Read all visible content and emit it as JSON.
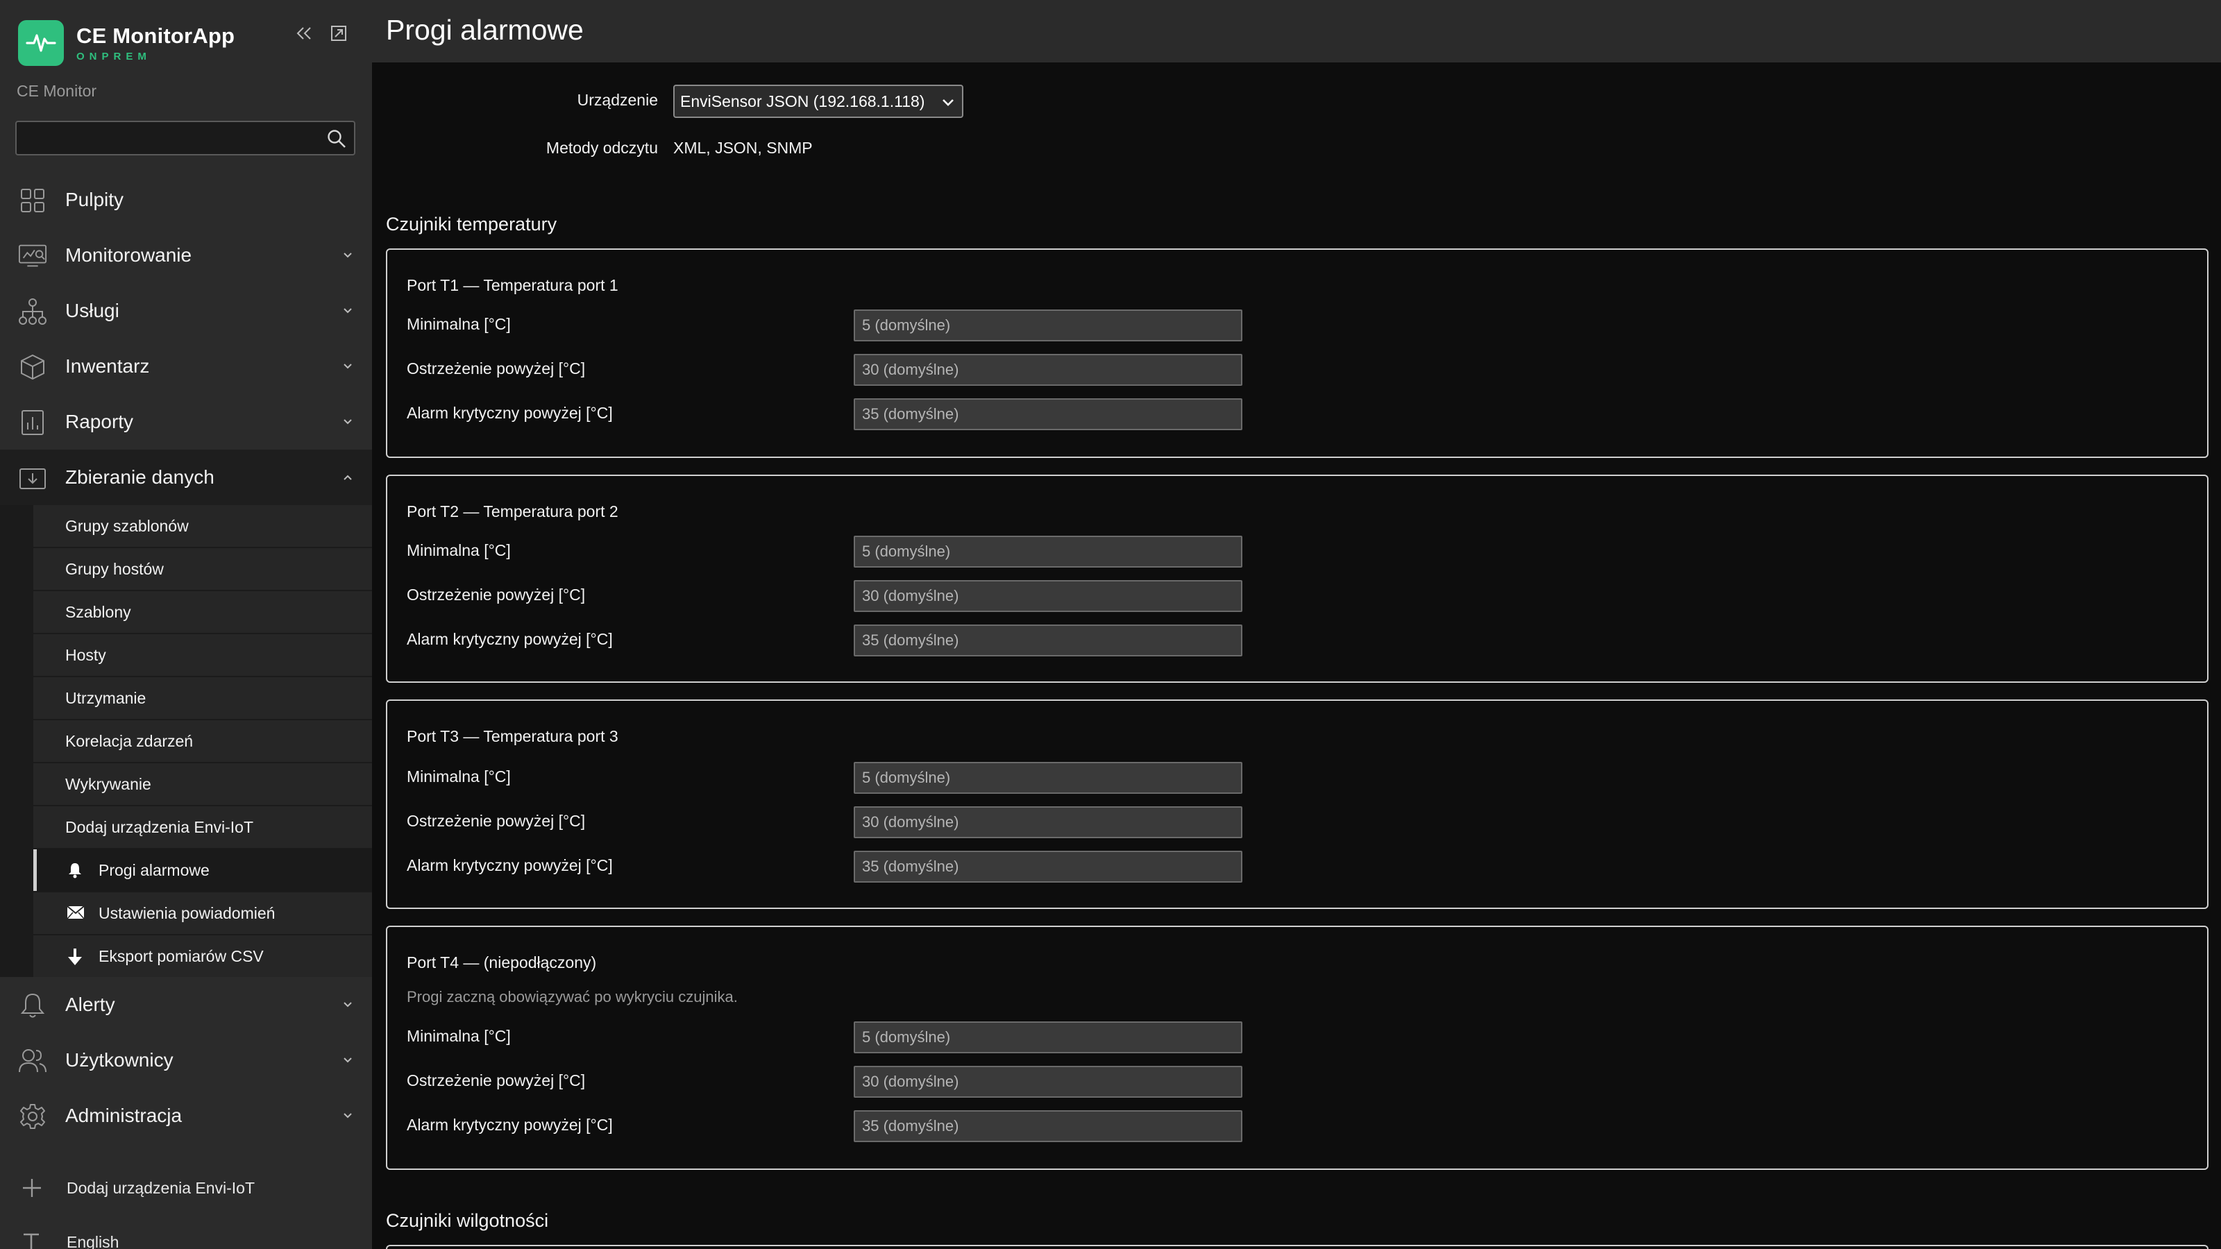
{
  "app": {
    "brand_name": "CE MonitorApp",
    "brand_sub": "ONPREM",
    "subtitle": "CE Monitor",
    "accent_color": "#2fbf7e"
  },
  "search": {
    "placeholder": "",
    "value": ""
  },
  "nav": {
    "items": [
      {
        "label": "Pulpity",
        "icon": "dashboard-grid-icon",
        "has_chevron": false
      },
      {
        "label": "Monitorowanie",
        "icon": "monitor-chart-icon",
        "has_chevron": true
      },
      {
        "label": "Usługi",
        "icon": "services-tree-icon",
        "has_chevron": true
      },
      {
        "label": "Inwentarz",
        "icon": "box-icon",
        "has_chevron": true
      },
      {
        "label": "Raporty",
        "icon": "report-icon",
        "has_chevron": true
      },
      {
        "label": "Zbieranie danych",
        "icon": "data-download-icon",
        "has_chevron": true,
        "expanded": true
      }
    ],
    "submenu": [
      {
        "label": "Grupy szablonów"
      },
      {
        "label": "Grupy hostów"
      },
      {
        "label": "Szablony"
      },
      {
        "label": "Hosty"
      },
      {
        "label": "Utrzymanie"
      },
      {
        "label": "Korelacja zdarzeń"
      },
      {
        "label": "Wykrywanie"
      },
      {
        "label": "Dodaj urządzenia Envi-IoT"
      },
      {
        "label": "Progi alarmowe",
        "icon": "bell-icon",
        "active": true
      },
      {
        "label": "Ustawienia powiadomień",
        "icon": "envelope-icon"
      },
      {
        "label": "Eksport pomiarów CSV",
        "icon": "arrow-down-icon"
      }
    ],
    "items_after": [
      {
        "label": "Alerty",
        "icon": "bell-outline-icon",
        "has_chevron": true
      },
      {
        "label": "Użytkownicy",
        "icon": "users-icon",
        "has_chevron": true
      },
      {
        "label": "Administracja",
        "icon": "gear-icon",
        "has_chevron": true
      }
    ],
    "bottom": [
      {
        "label": "Dodaj urządzenia Envi-IoT",
        "icon": "plus-icon"
      },
      {
        "label": "English",
        "icon": "text-t-icon"
      }
    ]
  },
  "page": {
    "title": "Progi alarmowe",
    "device_label": "Urządzenie",
    "device_value": "EnviSensor JSON (192.168.1.118)",
    "methods_label": "Metody odczytu",
    "methods_value": "XML, JSON, SNMP",
    "temp_section": "Czujniki temperatury",
    "humidity_section": "Czujniki wilgotności"
  },
  "ports": [
    {
      "title": "Port T1 — Temperatura port 1",
      "note": "",
      "fields": [
        {
          "label": "Minimalna [°C]",
          "placeholder": "5 (domyślne)"
        },
        {
          "label": "Ostrzeżenie powyżej [°C]",
          "placeholder": "30 (domyślne)"
        },
        {
          "label": "Alarm krytyczny powyżej [°C]",
          "placeholder": "35 (domyślne)"
        }
      ]
    },
    {
      "title": "Port T2 — Temperatura port 2",
      "note": "",
      "fields": [
        {
          "label": "Minimalna [°C]",
          "placeholder": "5 (domyślne)"
        },
        {
          "label": "Ostrzeżenie powyżej [°C]",
          "placeholder": "30 (domyślne)"
        },
        {
          "label": "Alarm krytyczny powyżej [°C]",
          "placeholder": "35 (domyślne)"
        }
      ]
    },
    {
      "title": "Port T3 — Temperatura port 3",
      "note": "",
      "fields": [
        {
          "label": "Minimalna [°C]",
          "placeholder": "5 (domyślne)"
        },
        {
          "label": "Ostrzeżenie powyżej [°C]",
          "placeholder": "30 (domyślne)"
        },
        {
          "label": "Alarm krytyczny powyżej [°C]",
          "placeholder": "35 (domyślne)"
        }
      ]
    },
    {
      "title": "Port T4 — (niepodłączony)",
      "note": "Progi zaczną obowiązywać po wykryciu czujnika.",
      "fields": [
        {
          "label": "Minimalna [°C]",
          "placeholder": "5 (domyślne)"
        },
        {
          "label": "Ostrzeżenie powyżej [°C]",
          "placeholder": "30 (domyślne)"
        },
        {
          "label": "Alarm krytyczny powyżej [°C]",
          "placeholder": "35 (domyślne)"
        }
      ]
    }
  ]
}
